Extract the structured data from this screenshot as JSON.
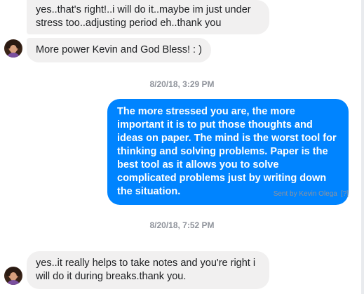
{
  "messages": {
    "msg1": "yes..that's right!..i will do it..maybe im just under stress too..adjusting period eh..thank you",
    "msg2": "More power Kevin and God Bless! : )",
    "timestamp1": "8/20/18, 3:29 PM",
    "msg3": "The more stressed you are, the more important it is to put those thoughts and ideas on paper. The mind is the worst tool for thinking and solving problems. Paper is the best tool as it allows you to solve complicated problems just by writing down the situation.",
    "sent_by": "Sent by Kevin Olega",
    "sent_by_help": "[?]",
    "timestamp2": "8/20/18, 7:52 PM",
    "msg4": "yes..it really helps to take notes and you're right i will do it during breaks.thank you."
  },
  "colors": {
    "outgoing_bubble": "#0084ff",
    "incoming_bubble": "#f1f0f0",
    "meta_text": "#90949c"
  }
}
